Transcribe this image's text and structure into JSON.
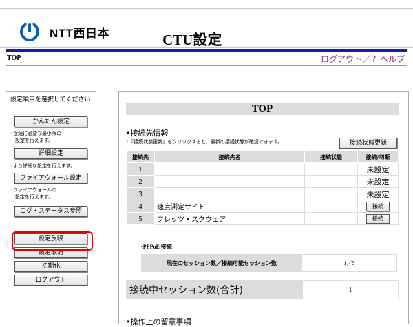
{
  "header": {
    "logo_text": "NTT西日本",
    "app_title": "CTU設定"
  },
  "breadcrumb": "TOP",
  "top_links": {
    "logout": "ログアウト",
    "separator": "／",
    "help": "？ヘルプ"
  },
  "sidebar": {
    "title": "設定項目を選択してください",
    "easy_setup": "かんたん設定",
    "easy_note_1": "◦接続に必要な最小限の",
    "easy_note_2": "　設定を行えます。",
    "detailed_setup": "詳細設定",
    "detailed_note": "◦より詳細な設定を行えます。",
    "firewall_setup": "ファイアウォール設定",
    "firewall_note_1": "◦ファイアウォールの",
    "firewall_note_2": "　設定を行えます。",
    "log_status": "ログ・ステータス参照",
    "apply": "設定反映",
    "cancel": "設定取消",
    "initialize": "初期化",
    "logout": "ログアウト"
  },
  "main": {
    "title": "TOP",
    "conn_heading": "•接続先情報",
    "conn_note": "◦『接続状態更新』をクリックすると、最新の接続状態が確認できます。",
    "refresh_button": "接続状態更新",
    "table_headers": [
      "接続先",
      "接続先名",
      "接続状態",
      "接続/切断"
    ],
    "rows": [
      {
        "num": "1",
        "name": "",
        "state": "",
        "action": "未設定",
        "is_button": false
      },
      {
        "num": "2",
        "name": "",
        "state": "",
        "action": "未設定",
        "is_button": false
      },
      {
        "num": "3",
        "name": "",
        "state": "",
        "action": "未設定",
        "is_button": false
      },
      {
        "num": "4",
        "name": "速度測定サイト",
        "state": "",
        "action": "接続",
        "is_button": true
      },
      {
        "num": "5",
        "name": "フレッツ・スクウェア",
        "state": "",
        "action": "接続",
        "is_button": true
      }
    ],
    "pppoe_heading": "•PPPoE 接続",
    "pppoe_label": "現在のセッション数／接続可能セッション数",
    "pppoe_value": "1／5",
    "session_label": "接続中セッション数(合計)",
    "session_value": "1",
    "notes_heading": "•操作上の留意事項"
  },
  "colors": {
    "accent_bar": "#1a1aa8",
    "highlight": "#e00000",
    "link": "#7a1d6b",
    "header_gray": "#dcdcdc"
  }
}
